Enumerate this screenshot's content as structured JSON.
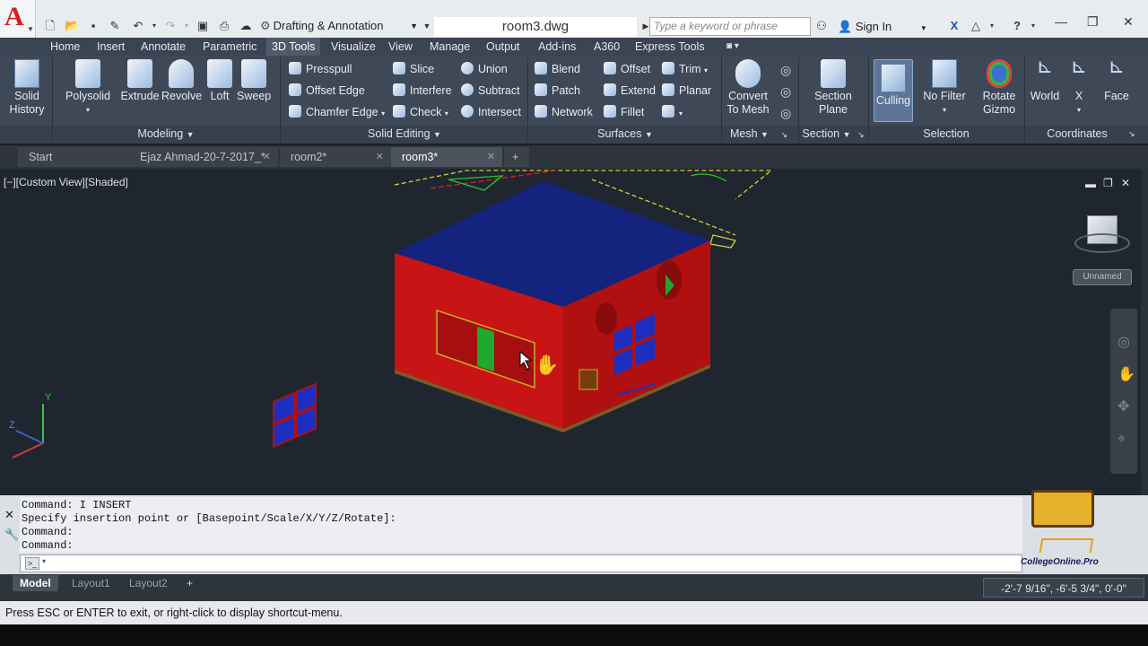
{
  "title_bar": {
    "workspace": "Drafting & Annotation",
    "document_title": "room3.dwg",
    "search_placeholder": "Type a keyword or phrase",
    "sign_in": "Sign In"
  },
  "ribbon_tabs": [
    "Home",
    "Insert",
    "Annotate",
    "Parametric",
    "3D Tools",
    "Visualize",
    "View",
    "Manage",
    "Output",
    "Add-ins",
    "A360",
    "Express Tools"
  ],
  "active_tab": "3D Tools",
  "ribbon": {
    "solid_history": [
      "Solid",
      "History"
    ],
    "modeling": {
      "polysolid": "Polysolid",
      "extrude": "Extrude",
      "revolve": "Revolve",
      "loft": "Loft",
      "sweep": "Sweep",
      "title": "Modeling"
    },
    "solid_editing": {
      "presspull": "Presspull",
      "offset_edge": "Offset Edge",
      "chamfer_edge": "Chamfer Edge",
      "slice": "Slice",
      "interfere": "Interfere",
      "check": "Check",
      "union": "Union",
      "subtract": "Subtract",
      "intersect": "Intersect",
      "title": "Solid Editing"
    },
    "surfaces": {
      "blend": "Blend",
      "patch": "Patch",
      "network": "Network",
      "offset": "Offset",
      "extend": "Extend",
      "fillet": "Fillet",
      "trim": "Trim",
      "planar": "Planar",
      "title": "Surfaces"
    },
    "mesh": {
      "convert": [
        "Convert",
        "To Mesh"
      ],
      "title": "Mesh"
    },
    "section": {
      "plane": [
        "Section",
        "Plane"
      ],
      "title": "Section"
    },
    "selection": {
      "culling": "Culling",
      "no_filter": "No Filter",
      "rotate_gizmo": [
        "Rotate",
        "Gizmo"
      ],
      "title": "Selection"
    },
    "coordinates": {
      "world": "World",
      "x": "X",
      "face": "Face",
      "title": "Coordinates"
    }
  },
  "doc_tabs": [
    {
      "label": "Start"
    },
    {
      "label": "Ejaz Ahmad-20-7-2017_*"
    },
    {
      "label": "room2*"
    },
    {
      "label": "room3*"
    }
  ],
  "viewport": {
    "label": "[−][Custom View][Shaded]",
    "viewcube_label": "Unnamed",
    "axis_y": "Y",
    "axis_z": "Z"
  },
  "command": {
    "lines": [
      "Command: I INSERT",
      "Specify insertion point or [Basepoint/Scale/X/Y/Z/Rotate]:",
      "Command:",
      "Command:"
    ],
    "prompt_icon": ">_"
  },
  "watermark": {
    "brand": "CollegeOnline.Pro"
  },
  "layout_tabs": [
    "Model",
    "Layout1",
    "Layout2"
  ],
  "coordinates_readout": "-2'-7 9/16\", -6'-5 3/4\", 0'-0\"",
  "status_text": "Press ESC or ENTER to exit, or right-click to display shortcut-menu.",
  "colors": {
    "wall_red": "#c81414",
    "roof_blue": "#13237e",
    "window_blue": "#1d2fc0",
    "viewport_bg": "#1f2630",
    "ribbon_bg": "#3f4856"
  }
}
